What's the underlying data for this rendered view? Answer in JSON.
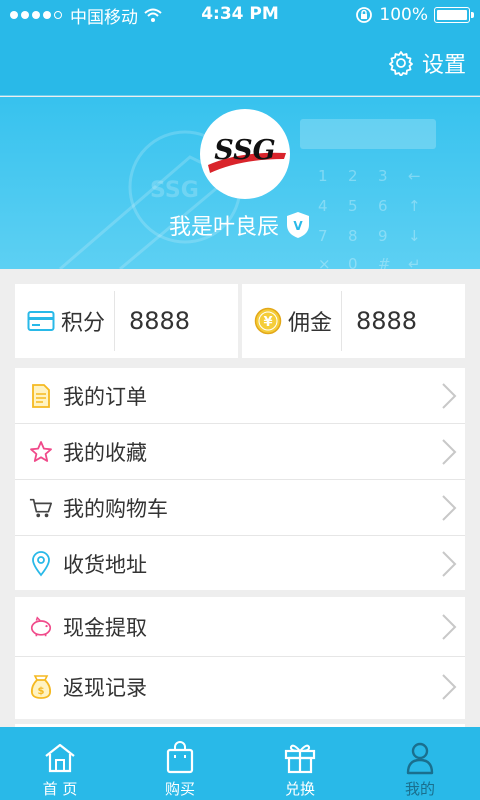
{
  "status_bar": {
    "carrier": "中国移动",
    "time": "4:34 PM",
    "battery": "100%",
    "battery_level": 1.0,
    "signal_bars_filled": 4,
    "signal_bars_total": 5
  },
  "header": {
    "settings_label": "设置"
  },
  "profile": {
    "logo_text": "SSG",
    "username": "我是叶良辰",
    "badge_letter": "V"
  },
  "stats": {
    "points": {
      "label": "积分",
      "value": "8888",
      "icon": "card-icon"
    },
    "commission": {
      "label": "佣金",
      "value": "8888",
      "icon": "yen-coin-icon"
    }
  },
  "menu": {
    "group1": [
      {
        "label": "我的订单",
        "icon": "document-icon",
        "color": "#f5b920"
      },
      {
        "label": "我的收藏",
        "icon": "star-icon",
        "color": "#f04a8a"
      },
      {
        "label": "我的购物车",
        "icon": "cart-icon",
        "color": "#333333"
      },
      {
        "label": "收货地址",
        "icon": "location-pin-icon",
        "color": "#29b9e8"
      }
    ],
    "group2": [
      {
        "label": "现金提取",
        "icon": "piggy-bank-icon",
        "color": "#f04a8a"
      },
      {
        "label": "返现记录",
        "icon": "money-bag-icon",
        "color": "#f5b920"
      }
    ]
  },
  "tabs": [
    {
      "label": "首 页",
      "icon": "home-icon",
      "active": false
    },
    {
      "label": "购买",
      "icon": "shopping-bag-icon",
      "active": false
    },
    {
      "label": "兑换",
      "icon": "gift-icon",
      "active": false
    },
    {
      "label": "我的",
      "icon": "user-icon",
      "active": true
    }
  ],
  "colors": {
    "primary": "#29b9e8",
    "active_tab": "#1a6f8e",
    "background": "#eeeeee"
  }
}
